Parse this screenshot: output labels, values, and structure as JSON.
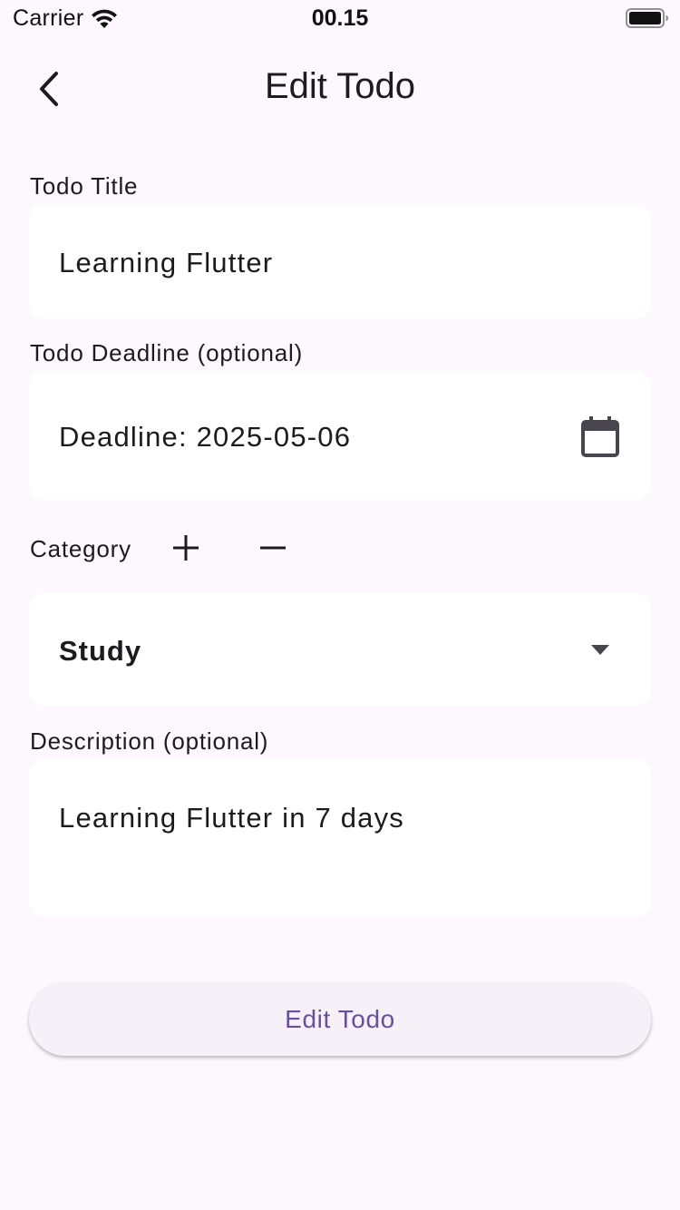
{
  "status_bar": {
    "carrier": "Carrier",
    "time": "00.15",
    "icons": [
      "wifi-icon",
      "battery-icon"
    ]
  },
  "app_bar": {
    "back_icon": "chevron-left-icon",
    "title": "Edit Todo"
  },
  "form": {
    "title": {
      "label": "Todo Title",
      "value": "Learning Flutter"
    },
    "deadline": {
      "label": "Todo Deadline (optional)",
      "value": "Deadline: 2025-05-06",
      "icon": "calendar-icon"
    },
    "category": {
      "label": "Category",
      "add_icon": "plus-icon",
      "remove_icon": "minus-icon",
      "selected": "Study",
      "dropdown_icon": "caret-down-icon"
    },
    "description": {
      "label": "Description (optional)",
      "value": "Learning Flutter in 7 days"
    },
    "submit_label": "Edit Todo"
  },
  "colors": {
    "background": "#fdf7fe",
    "field_background": "#ffffff",
    "button_background": "#f6f1f8",
    "button_text": "#6750a4",
    "text": "#1d1b20",
    "icon": "#49454f"
  }
}
